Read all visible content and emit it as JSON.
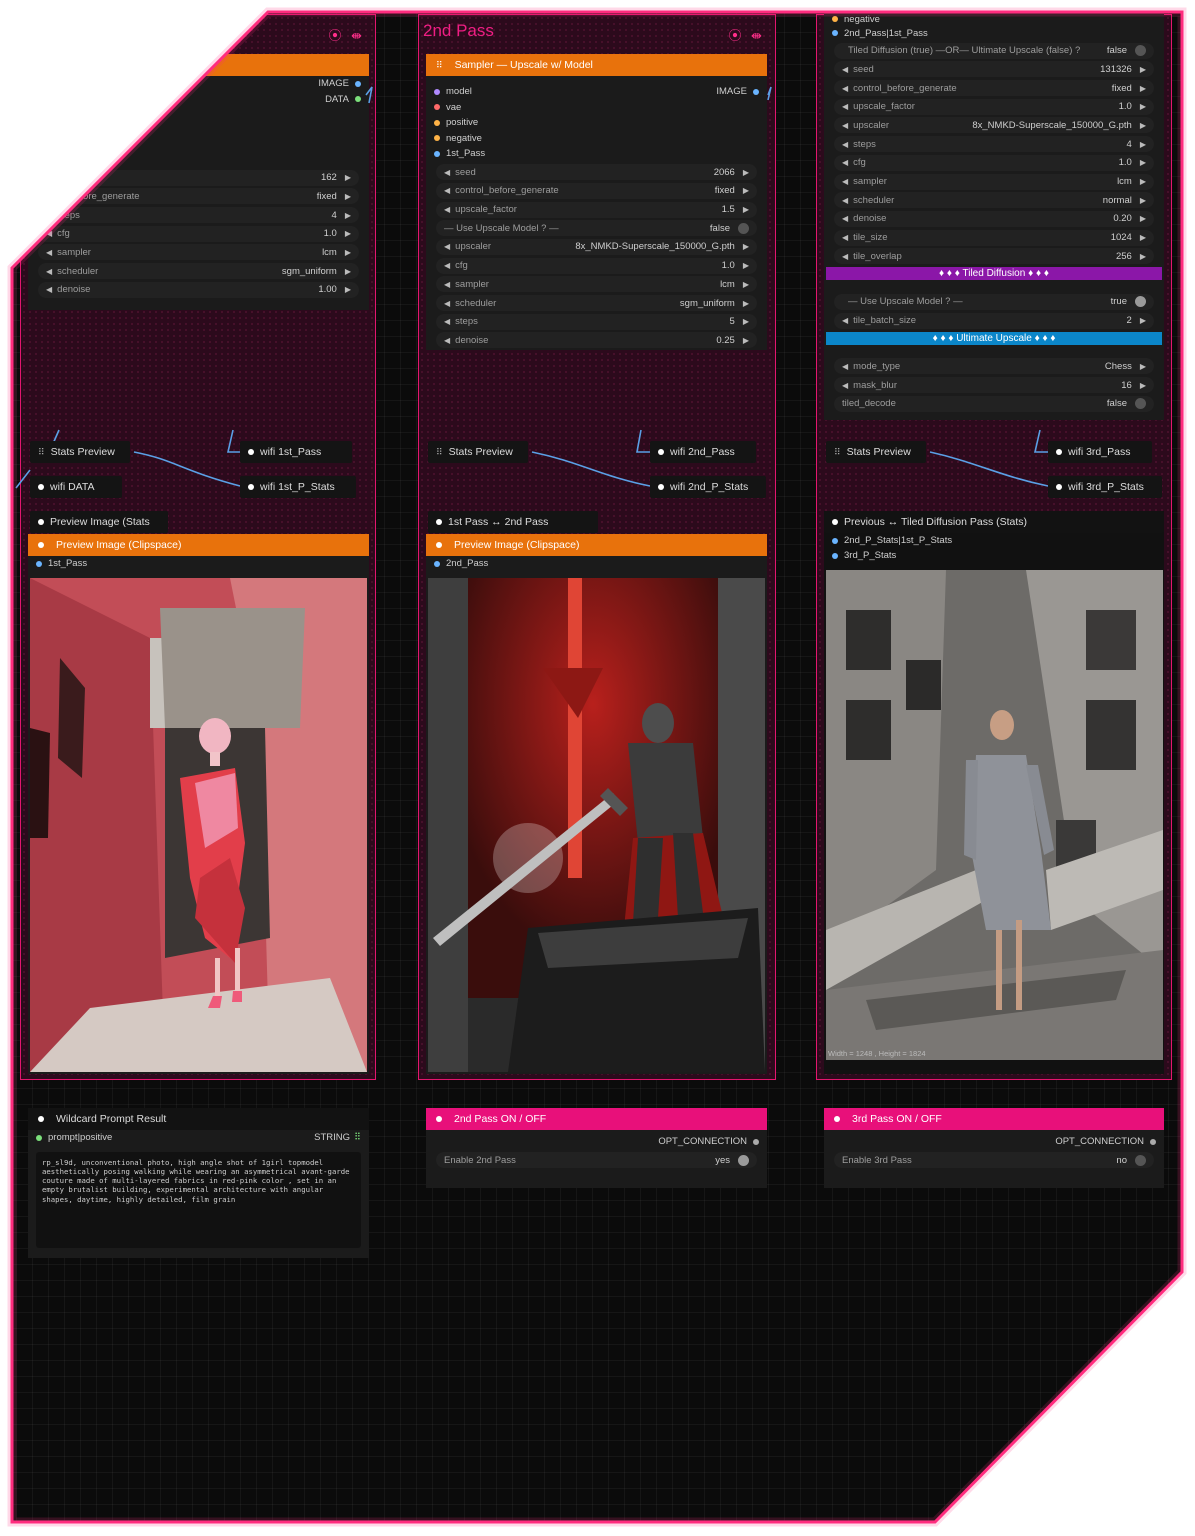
{
  "columns": {
    "first": {
      "title": "",
      "head_label": "",
      "outputs": [
        "IMAGE",
        "DATA"
      ],
      "widgets": [
        {
          "label": "",
          "value": "162"
        },
        {
          "label": "ol_before_generate",
          "value": "fixed"
        },
        {
          "label": "steps",
          "value": "4"
        },
        {
          "label": "cfg",
          "value": "1.0"
        },
        {
          "label": "sampler",
          "value": "lcm"
        },
        {
          "label": "scheduler",
          "value": "sgm_uniform"
        },
        {
          "label": "denoise",
          "value": "1.00"
        }
      ],
      "stats_preview": "Stats Preview",
      "wifi_a": "wifi 1st_Pass",
      "wifi_b": "wifi 1st_P_Stats",
      "wifi_c": "wifi DATA",
      "preview_stats": "Preview Image (Stats",
      "preview_clip": "Preview Image (Clipspace)",
      "image_input": "1st_Pass"
    },
    "second": {
      "title": "2nd Pass",
      "head_label": "Sampler — Upscale w/ Model",
      "output": "IMAGE",
      "inputs": [
        "model",
        "vae",
        "positive",
        "negative",
        "1st_Pass"
      ],
      "widgets": [
        {
          "label": "seed",
          "value": "2066"
        },
        {
          "label": "control_before_generate",
          "value": "fixed"
        },
        {
          "label": "upscale_factor",
          "value": "1.5"
        },
        {
          "label": "— Use Upscale Model ? —",
          "value": "false",
          "toggle": true
        },
        {
          "label": "upscaler",
          "value": "8x_NMKD-Superscale_150000_G.pth"
        },
        {
          "label": "cfg",
          "value": "1.0"
        },
        {
          "label": "sampler",
          "value": "lcm"
        },
        {
          "label": "scheduler",
          "value": "sgm_uniform"
        },
        {
          "label": "steps",
          "value": "5"
        },
        {
          "label": "denoise",
          "value": "0.25"
        }
      ],
      "stats_preview": "Stats Preview",
      "wifi_a": "wifi 2nd_Pass",
      "wifi_b": "wifi 2nd_P_Stats",
      "compare": "1st Pass ↔ 2nd Pass",
      "preview_clip": "Preview Image (Clipspace)",
      "image_input": "2nd_Pass"
    },
    "third": {
      "inputs": [
        "negative",
        "2nd_Pass|1st_Pass"
      ],
      "choice": {
        "label": "Tiled Diffusion (true) —OR— Ultimate Upscale (false) ?",
        "value": "false"
      },
      "widgets": [
        {
          "label": "seed",
          "value": "131326"
        },
        {
          "label": "control_before_generate",
          "value": "fixed"
        },
        {
          "label": "upscale_factor",
          "value": "1.0"
        },
        {
          "label": "upscaler",
          "value": "8x_NMKD-Superscale_150000_G.pth"
        },
        {
          "label": "steps",
          "value": "4"
        },
        {
          "label": "cfg",
          "value": "1.0"
        },
        {
          "label": "sampler",
          "value": "lcm"
        },
        {
          "label": "scheduler",
          "value": "normal"
        },
        {
          "label": "denoise",
          "value": "0.20"
        },
        {
          "label": "tile_size",
          "value": "1024"
        },
        {
          "label": "tile_overlap",
          "value": "256"
        }
      ],
      "band_tiled": "♦ ♦ ♦ Tiled Diffusion ♦ ♦ ♦",
      "use_upscale": {
        "label": "— Use Upscale Model ? —",
        "value": "true"
      },
      "tile_batch": {
        "label": "tile_batch_size",
        "value": "2"
      },
      "band_ultimate": "♦ ♦ ♦ Ultimate Upscale ♦ ♦ ♦",
      "ult_widgets": [
        {
          "label": "mode_type",
          "value": "Chess"
        },
        {
          "label": "mask_blur",
          "value": "16"
        }
      ],
      "tiled_decode": {
        "label": "tiled_decode",
        "value": "false"
      },
      "stats_preview": "Stats Preview",
      "wifi_a": "wifi 3rd_Pass",
      "wifi_b": "wifi 3rd_P_Stats",
      "compare": "Previous ↔ Tiled Diffusion Pass (Stats)",
      "compare_inputs": [
        "2nd_P_Stats|1st_P_Stats",
        "3rd_P_Stats"
      ],
      "image_caption": "Width = 1248 , Height = 1824"
    }
  },
  "bottom": {
    "wildcard_title": "Wildcard Prompt Result",
    "wildcard_input": "prompt|positive",
    "wildcard_type": "STRING",
    "prompt_text": "rp_sl9d, unconventional photo, high angle shot of 1girl topmodel aesthetically posing walking while wearing an asymmetrical avant-garde couture made of multi-layered fabrics in red-pink color , set in an empty brutalist building, experimental architecture with angular shapes, daytime, highly detailed, film grain",
    "toggle2": {
      "title": "2nd Pass  ON / OFF",
      "output": "OPT_CONNECTION",
      "label": "Enable 2nd Pass",
      "value": "yes"
    },
    "toggle3": {
      "title": "3rd Pass  ON / OFF",
      "output": "OPT_CONNECTION",
      "label": "Enable 3rd Pass",
      "value": "no"
    }
  },
  "colors": {
    "accent_pink": "#e8107a",
    "accent_orange": "#e8720c",
    "band_purple": "#8b17a8",
    "band_blue": "#0b86c9",
    "link_blue": "#5aa0e6"
  }
}
